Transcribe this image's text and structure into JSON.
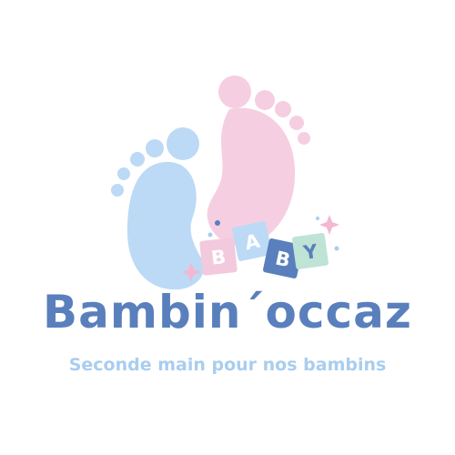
{
  "logo": {
    "brand_name": "Bambin´occaz",
    "tagline": "Seconde main pour nos bambins",
    "blocks": [
      "B",
      "A",
      "B",
      "Y"
    ],
    "colors": {
      "brand_text": "#5a7fbd",
      "tagline_text": "#a9cdef",
      "blue_foot": "#bcdaf6",
      "pink_foot": "#f5cfe1",
      "block_pink": "#f3c9dd",
      "block_light_blue": "#bcdaf6",
      "block_dark_blue": "#5a7fbd",
      "block_green": "#bfe3d4",
      "sparkle_pink": "#f3b7d2",
      "sparkle_blue": "#a9cdef"
    }
  }
}
